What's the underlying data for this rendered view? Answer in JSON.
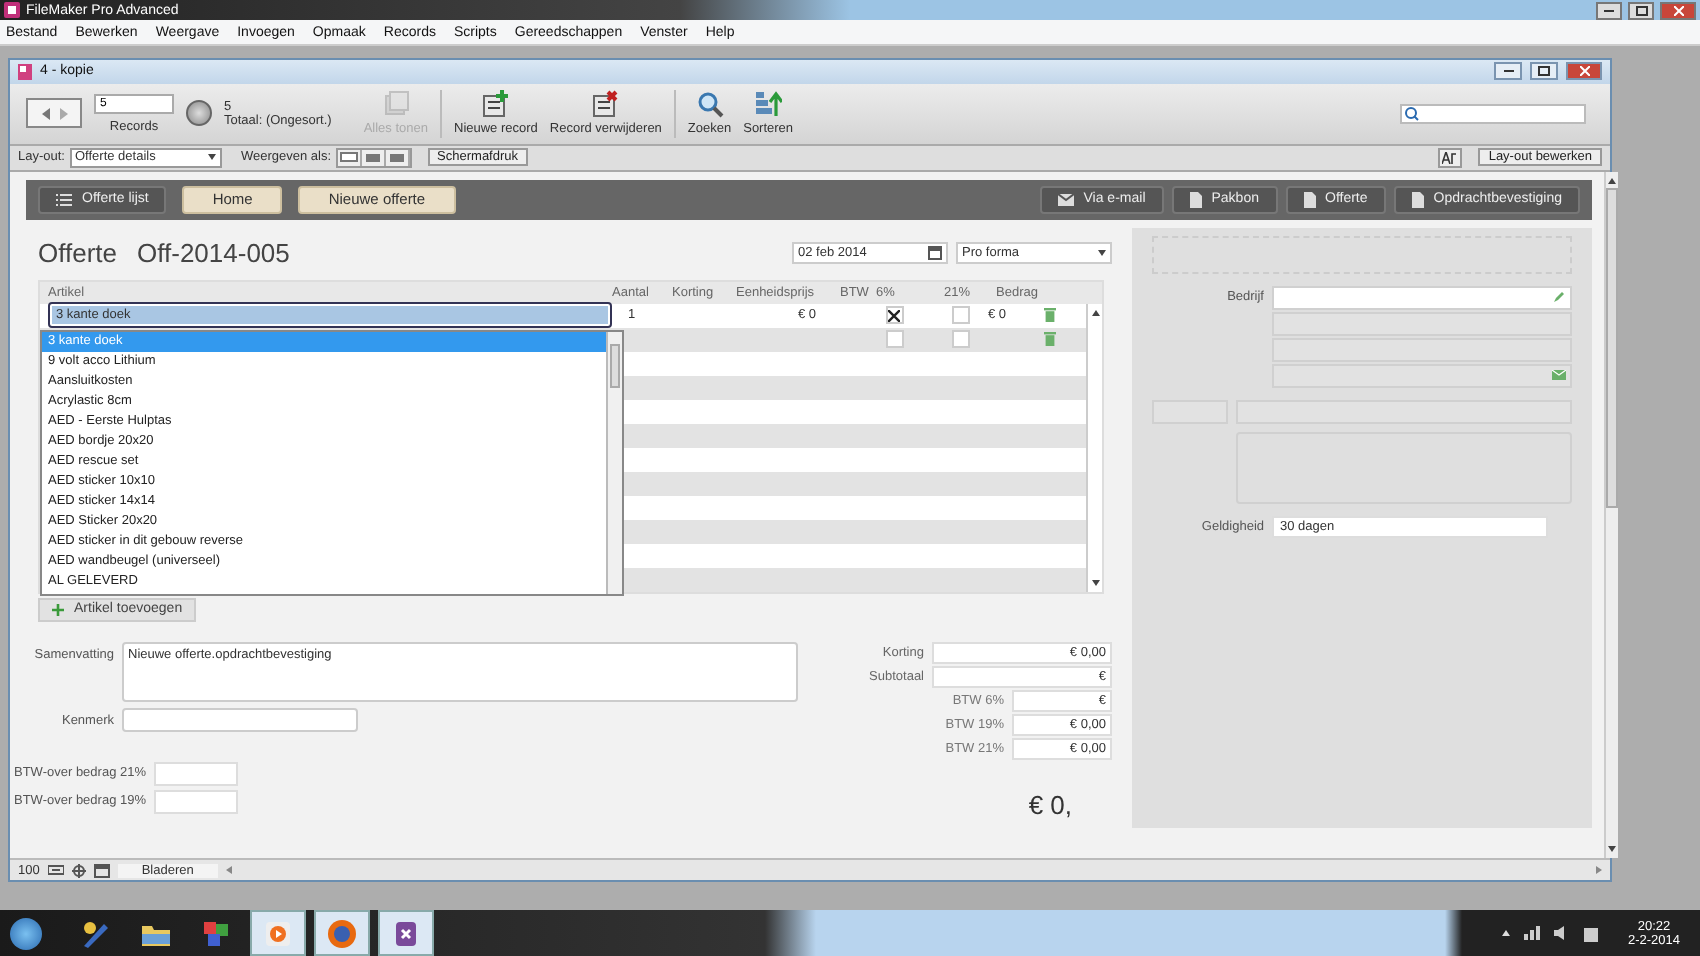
{
  "app": {
    "title": "FileMaker Pro Advanced"
  },
  "menu": [
    "Bestand",
    "Bewerken",
    "Weergave",
    "Invoegen",
    "Opmaak",
    "Records",
    "Scripts",
    "Gereedschappen",
    "Venster",
    "Help"
  ],
  "window": {
    "title": "4 - kopie"
  },
  "toolbar": {
    "record_field": "5",
    "records_label": "Records",
    "found_count": "5",
    "total_label": "Totaal: (Ongesort.)",
    "buttons": [
      {
        "label": "Alles tonen",
        "disabled": true,
        "kind": "show-all"
      },
      {
        "label": "Nieuwe record",
        "disabled": false,
        "kind": "new"
      },
      {
        "label": "Record verwijderen",
        "disabled": false,
        "kind": "delete"
      },
      {
        "label": "Zoeken",
        "disabled": false,
        "kind": "find"
      },
      {
        "label": "Sorteren",
        "disabled": false,
        "kind": "sort"
      }
    ]
  },
  "layout_bar": {
    "layout_label": "Lay-out:",
    "layout_value": "Offerte details",
    "view_label": "Weergeven als:",
    "preview_button": "Schermafdruk",
    "edit_button": "Lay-out bewerken"
  },
  "nav": {
    "left": [
      {
        "label": "Offerte lijst",
        "kind": "list"
      },
      {
        "label": "Home",
        "kind": "tab"
      },
      {
        "label": "Nieuwe offerte",
        "kind": "tab"
      }
    ],
    "right": [
      {
        "label": "Via e-mail",
        "kind": "mail"
      },
      {
        "label": "Pakbon",
        "kind": "doc"
      },
      {
        "label": "Offerte",
        "kind": "doc"
      },
      {
        "label": "Opdrachtbevestiging",
        "kind": "doc"
      }
    ]
  },
  "heading": {
    "label": "Offerte",
    "number": "Off-2014-005"
  },
  "date": "02 feb 2014",
  "doc_type": "Pro forma",
  "table": {
    "columns": [
      "Artikel",
      "Aantal",
      "Korting",
      "Eenheidsprijs",
      "BTW",
      "6%",
      "21%",
      "Bedrag"
    ],
    "rows": [
      {
        "article": "3 kante doek",
        "quantity": "1",
        "unit_price": "€ 0",
        "vat_6": true,
        "vat_21": false,
        "amount": "€ 0"
      },
      {
        "vat_6": false,
        "vat_21": false
      }
    ]
  },
  "dropdown": {
    "items": [
      {
        "label": "3 kante doek",
        "selected": true
      },
      {
        "label": "9 volt acco Lithium",
        "selected": false
      },
      {
        "label": "Aansluitkosten",
        "selected": false
      },
      {
        "label": "Acrylastic 8cm",
        "selected": false
      },
      {
        "label": "AED - Eerste Hulptas",
        "selected": false
      },
      {
        "label": "AED bordje 20x20",
        "selected": false
      },
      {
        "label": "AED rescue set",
        "selected": false
      },
      {
        "label": "AED sticker 10x10",
        "selected": false
      },
      {
        "label": "AED sticker 14x14",
        "selected": false
      },
      {
        "label": "AED Sticker 20x20",
        "selected": false
      },
      {
        "label": "AED sticker in dit gebouw reverse",
        "selected": false
      },
      {
        "label": "AED wandbeugel (universeel)",
        "selected": false
      },
      {
        "label": "AL GELEVERD",
        "selected": false
      }
    ]
  },
  "add_button": "Artikel toevoegen",
  "summary": {
    "label": "Samenvatting",
    "value": "Nieuwe offerte.opdrachtbevestiging"
  },
  "reference": {
    "label": "Kenmerk"
  },
  "vat_base": [
    {
      "label": "BTW-over bedrag 21%"
    },
    {
      "label": "BTW-over bedrag 19%"
    }
  ],
  "totals": [
    {
      "label": "Korting",
      "value": "€ 0,00",
      "kind": "wide"
    },
    {
      "label": "Subtotaal",
      "value": "€",
      "kind": "wide"
    },
    {
      "label": "BTW 6%",
      "value": "€",
      "kind": "narrow"
    },
    {
      "label": "BTW 19%",
      "value": "€ 0,00",
      "kind": "narrow"
    },
    {
      "label": "BTW 21%",
      "value": "€ 0,00",
      "kind": "narrow"
    }
  ],
  "grand_total": "€ 0,",
  "side": {
    "company_label": "Bedrijf",
    "validity_label": "Geldigheid",
    "validity_value": "30 dagen"
  },
  "status_bar": {
    "zoom": "100",
    "mode": "Bladeren"
  },
  "taskbar": {
    "apps": [
      {
        "kind": "tools",
        "selected": false
      },
      {
        "kind": "folder",
        "selected": false
      },
      {
        "kind": "blocks",
        "selected": false
      },
      {
        "kind": "media",
        "selected": true
      },
      {
        "kind": "browser",
        "selected": true
      },
      {
        "kind": "database",
        "selected": true
      }
    ],
    "time": "20:22",
    "date": "2-2-2014"
  }
}
